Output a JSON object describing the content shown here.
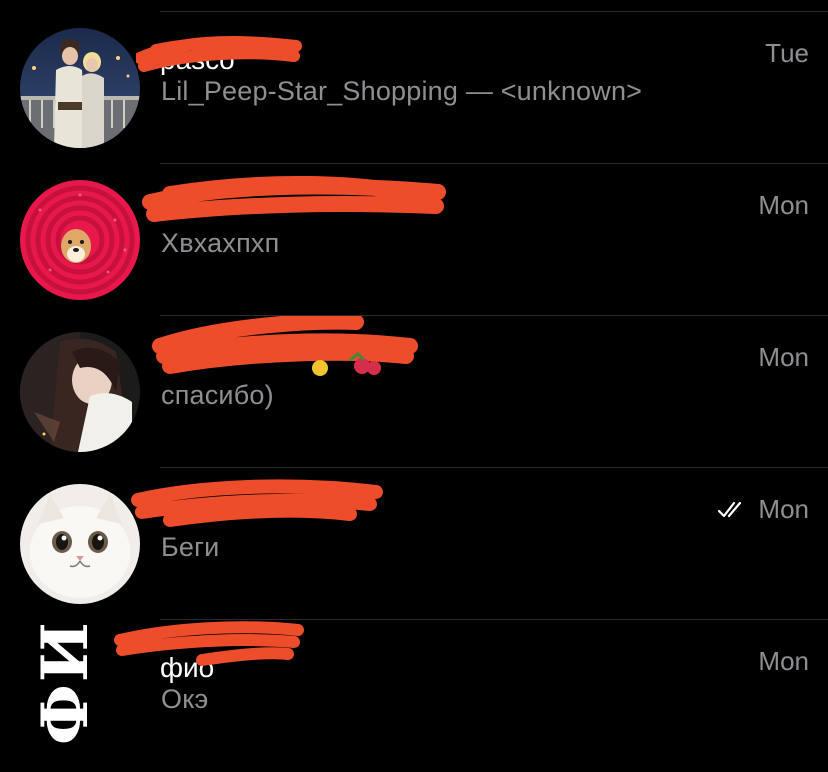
{
  "chats": [
    {
      "name": "pasco",
      "preview": "Lil_Peep-Star_Shopping — <unknown>",
      "time": "Tue",
      "read_check": false,
      "avatar": "avatar-couple-photo"
    },
    {
      "name": "",
      "preview": "Хвхахпхп",
      "time": "Mon",
      "read_check": false,
      "avatar": "avatar-dog-in-hoodie"
    },
    {
      "name": "",
      "preview": "спасибо)",
      "time": "Mon",
      "read_check": false,
      "avatar": "avatar-girl-selfie"
    },
    {
      "name": "",
      "preview": "Беги",
      "time": "Mon",
      "read_check": true,
      "avatar": "avatar-white-cat"
    },
    {
      "name": "фио",
      "preview": "Окэ",
      "time": "Mon",
      "read_check": false,
      "avatar": "avatar-text-logo",
      "avatar_text": "ФИО"
    }
  ],
  "colors": {
    "background": "#000000",
    "name_text": "#ffffff",
    "secondary_text": "#8e8e93",
    "divider": "#2a2a2d",
    "redaction": "#ee4d2c"
  },
  "icons": {
    "read_receipt": "double-check-icon"
  }
}
